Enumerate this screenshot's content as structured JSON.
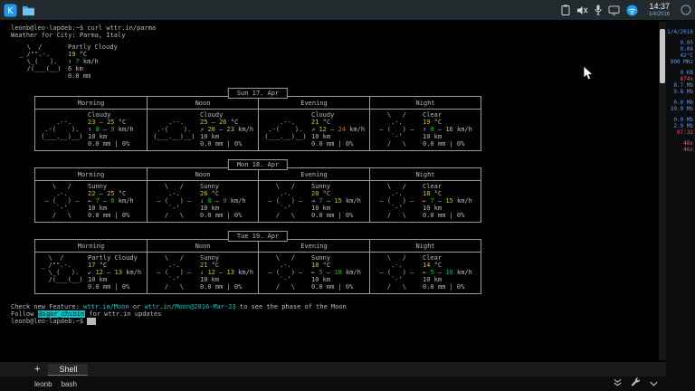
{
  "panel": {
    "time": "14:37",
    "date": "1/4/2016",
    "left_icons": [
      "app-launcher-icon",
      "file-manager-icon"
    ],
    "tray_icons": [
      "clipboard-icon",
      "volume-muted-icon",
      "microphone-icon",
      "display-icon",
      "network-icon"
    ],
    "show_desktop_icon": "show-desktop-icon"
  },
  "terminal": {
    "lines_top": [
      {
        "segs": [
          {
            "t": "leonb@leo-lapdeb:~$ curl wttr.in/parma",
            "c": "w"
          }
        ]
      },
      {
        "segs": [
          {
            "t": "Weather for City: Parma, Italy",
            "c": "w"
          }
        ]
      }
    ],
    "current": {
      "icon": "partly-cloudy",
      "condition": "Partly Cloudy",
      "temp": [
        {
          "t": "19",
          "c": "y"
        },
        {
          "t": " °C",
          "c": "w"
        }
      ],
      "wind": [
        {
          "t": "↑ ",
          "c": "w"
        },
        {
          "t": "7",
          "c": "g"
        },
        {
          "t": " km/h",
          "c": "w"
        }
      ],
      "visibility": "6 km",
      "precip": "0.0 mm"
    },
    "periods": [
      "Morning",
      "Noon",
      "Evening",
      "Night"
    ],
    "days": [
      {
        "label": "Sun 17. Apr",
        "cells": [
          {
            "icon": "cloudy",
            "condition": "Cloudy",
            "temp": [
              {
                "t": "23",
                "c": "y"
              },
              {
                "t": " – ",
                "c": "w"
              },
              {
                "t": "25",
                "c": "y"
              },
              {
                "t": " °C",
                "c": "w"
              }
            ],
            "wind": [
              {
                "t": "↑ ",
                "c": "w"
              },
              {
                "t": "8",
                "c": "g"
              },
              {
                "t": " – ",
                "c": "w"
              },
              {
                "t": "9",
                "c": "g"
              },
              {
                "t": " km/h",
                "c": "w"
              }
            ],
            "visibility": "10 km",
            "precip": "0.0 mm | 0%"
          },
          {
            "icon": "cloudy",
            "condition": "Cloudy",
            "temp": [
              {
                "t": "25",
                "c": "y"
              },
              {
                "t": " – ",
                "c": "w"
              },
              {
                "t": "26",
                "c": "y"
              },
              {
                "t": " °C",
                "c": "w"
              }
            ],
            "wind": [
              {
                "t": "↗ ",
                "c": "w"
              },
              {
                "t": "20",
                "c": "y"
              },
              {
                "t": " – ",
                "c": "w"
              },
              {
                "t": "23",
                "c": "y"
              },
              {
                "t": " km/h",
                "c": "w"
              }
            ],
            "visibility": "10 km",
            "precip": "0.0 mm | 0%"
          },
          {
            "icon": "cloudy",
            "condition": "Cloudy",
            "temp": [
              {
                "t": "21",
                "c": "y"
              },
              {
                "t": " °C",
                "c": "w"
              }
            ],
            "wind": [
              {
                "t": "↗ ",
                "c": "w"
              },
              {
                "t": "12",
                "c": "y"
              },
              {
                "t": " – ",
                "c": "w"
              },
              {
                "t": "24",
                "c": "o"
              },
              {
                "t": " km/h",
                "c": "w"
              }
            ],
            "visibility": "10 km",
            "precip": "0.0 mm | 0%"
          },
          {
            "icon": "clear",
            "condition": "Clear",
            "temp": [
              {
                "t": "19",
                "c": "y"
              },
              {
                "t": " °C",
                "c": "w"
              }
            ],
            "wind": [
              {
                "t": "↑ ",
                "c": "w"
              },
              {
                "t": "8",
                "c": "g"
              },
              {
                "t": " – ",
                "c": "w"
              },
              {
                "t": "16",
                "c": "y"
              },
              {
                "t": " km/h",
                "c": "w"
              }
            ],
            "visibility": "10 km",
            "precip": "0.0 mm | 0%"
          }
        ]
      },
      {
        "label": "Mon 18. Apr",
        "cells": [
          {
            "icon": "sunny",
            "condition": "Sunny",
            "temp": [
              {
                "t": "22",
                "c": "y"
              },
              {
                "t": " – ",
                "c": "w"
              },
              {
                "t": "25",
                "c": "y"
              },
              {
                "t": " °C",
                "c": "w"
              }
            ],
            "wind": [
              {
                "t": "← ",
                "c": "w"
              },
              {
                "t": "7",
                "c": "g"
              },
              {
                "t": " – ",
                "c": "w"
              },
              {
                "t": "8",
                "c": "g"
              },
              {
                "t": " km/h",
                "c": "w"
              }
            ],
            "visibility": "10 km",
            "precip": "0.0 mm | 0%"
          },
          {
            "icon": "sunny",
            "condition": "Sunny",
            "temp": [
              {
                "t": "26",
                "c": "y"
              },
              {
                "t": " °C",
                "c": "w"
              }
            ],
            "wind": [
              {
                "t": "↓ ",
                "c": "w"
              },
              {
                "t": "8",
                "c": "g"
              },
              {
                "t": " – ",
                "c": "w"
              },
              {
                "t": "9",
                "c": "g"
              },
              {
                "t": " km/h",
                "c": "w"
              }
            ],
            "visibility": "10 km",
            "precip": "0.0 mm | 0%"
          },
          {
            "icon": "sunny",
            "condition": "Sunny",
            "temp": [
              {
                "t": "20",
                "c": "y"
              },
              {
                "t": " °C",
                "c": "w"
              }
            ],
            "wind": [
              {
                "t": "→ ",
                "c": "w"
              },
              {
                "t": "7",
                "c": "g"
              },
              {
                "t": " – ",
                "c": "w"
              },
              {
                "t": "15",
                "c": "y"
              },
              {
                "t": " km/h",
                "c": "w"
              }
            ],
            "visibility": "10 km",
            "precip": "0.0 mm | 0%"
          },
          {
            "icon": "clear",
            "condition": "Clear",
            "temp": [
              {
                "t": "18",
                "c": "y"
              },
              {
                "t": " °C",
                "c": "w"
              }
            ],
            "wind": [
              {
                "t": "← ",
                "c": "w"
              },
              {
                "t": "7",
                "c": "g"
              },
              {
                "t": " – ",
                "c": "w"
              },
              {
                "t": "15",
                "c": "y"
              },
              {
                "t": " km/h",
                "c": "w"
              }
            ],
            "visibility": "10 km",
            "precip": "0.0 mm | 0%"
          }
        ]
      },
      {
        "label": "Tue 19. Apr",
        "cells": [
          {
            "icon": "partly-cloudy",
            "condition": "Partly Cloudy",
            "temp": [
              {
                "t": "17",
                "c": "y"
              },
              {
                "t": " °C",
                "c": "w"
              }
            ],
            "wind": [
              {
                "t": "↙ ",
                "c": "w"
              },
              {
                "t": "12",
                "c": "y"
              },
              {
                "t": " – ",
                "c": "w"
              },
              {
                "t": "13",
                "c": "y"
              },
              {
                "t": " km/h",
                "c": "w"
              }
            ],
            "visibility": "10 km",
            "precip": "0.0 mm | 0%"
          },
          {
            "icon": "sunny",
            "condition": "Sunny",
            "temp": [
              {
                "t": "21",
                "c": "y"
              },
              {
                "t": " °C",
                "c": "w"
              }
            ],
            "wind": [
              {
                "t": "↓ ",
                "c": "w"
              },
              {
                "t": "12",
                "c": "y"
              },
              {
                "t": " – ",
                "c": "w"
              },
              {
                "t": "13",
                "c": "y"
              },
              {
                "t": " km/h",
                "c": "w"
              }
            ],
            "visibility": "10 km",
            "precip": "0.0 mm | 0%"
          },
          {
            "icon": "sunny",
            "condition": "Sunny",
            "temp": [
              {
                "t": "18",
                "c": "y"
              },
              {
                "t": " °C",
                "c": "w"
              }
            ],
            "wind": [
              {
                "t": "← ",
                "c": "w"
              },
              {
                "t": "5",
                "c": "g"
              },
              {
                "t": " – ",
                "c": "w"
              },
              {
                "t": "10",
                "c": "g"
              },
              {
                "t": " km/h",
                "c": "w"
              }
            ],
            "visibility": "10 km",
            "precip": "0.0 mm | 0%"
          },
          {
            "icon": "clear",
            "condition": "Clear",
            "temp": [
              {
                "t": "14",
                "c": "y"
              },
              {
                "t": " °C",
                "c": "w"
              }
            ],
            "wind": [
              {
                "t": "← ",
                "c": "w"
              },
              {
                "t": "5",
                "c": "g"
              },
              {
                "t": " – ",
                "c": "w"
              },
              {
                "t": "10",
                "c": "g"
              },
              {
                "t": " km/h",
                "c": "w"
              }
            ],
            "visibility": "10 km",
            "precip": "0.0 mm | 0%"
          }
        ]
      }
    ],
    "icons": {
      "partly-cloudy": [
        "   \\  /",
        " _ /\"\".-.",
        "   \\_(   ).",
        "   /(___(__)",
        ""
      ],
      "cloudy": [
        "",
        "     .--.",
        "  .-(    ).",
        " (___.__)__)",
        ""
      ],
      "sunny": [
        "    \\   /",
        "     .-.",
        "  ― (   ) ―",
        "     `-’",
        "    /   \\"
      ],
      "clear": [
        "    \\   /",
        "     .-.",
        "  ― (   ) ―",
        "     `-’",
        "    /   \\"
      ]
    },
    "lines_bottom": [
      {
        "segs": [
          {
            "t": "Check new Feature: ",
            "c": "w"
          },
          {
            "t": "wttr.in/Moon",
            "c": "c"
          },
          {
            "t": " or ",
            "c": "w"
          },
          {
            "t": "wttr.in/Moon@2016-Mar-23",
            "c": "c"
          },
          {
            "t": " to see the phase of the Moon",
            "c": "w"
          }
        ]
      },
      {
        "segs": [
          {
            "t": "Follow ",
            "c": "w"
          },
          {
            "t": "@igor_chubin",
            "c": "hl"
          },
          {
            "t": " for wttr.in updates",
            "c": "w"
          }
        ]
      },
      {
        "segs": [
          {
            "t": "leonb@leo-lapdeb:~$ ",
            "c": "w"
          },
          {
            "t": " ",
            "c": "cur"
          }
        ]
      }
    ]
  },
  "tabbar": {
    "new_tab_label": "+",
    "tab_label": "Shell"
  },
  "statusbar": {
    "items": [
      "leonb",
      "bash"
    ],
    "icons": [
      "chevrons-down-icon",
      "wrench-icon",
      "chevron-down-icon"
    ]
  },
  "monitor": {
    "lines": [
      {
        "t": "1/4/2016",
        "c": "b"
      },
      {
        "t": "",
        "c": "b"
      },
      {
        "t": "0.05",
        "c": "b"
      },
      {
        "t": "0.08",
        "c": "b"
      },
      {
        "t": "42°C",
        "c": "b"
      },
      {
        "t": "800 MHz",
        "c": "b"
      },
      {
        "t": "",
        "c": "b"
      },
      {
        "t": "0 KB",
        "c": "b"
      },
      {
        "t": "874x",
        "c": "r"
      },
      {
        "t": "8.7 Mb",
        "c": "b"
      },
      {
        "t": "9.8 Mb",
        "c": "b"
      },
      {
        "t": "",
        "c": "b"
      },
      {
        "t": "0.0 Mb",
        "c": "b"
      },
      {
        "t": "39.9 Mb",
        "c": "b"
      },
      {
        "t": "",
        "c": "b"
      },
      {
        "t": "0.0 Mb",
        "c": "b"
      },
      {
        "t": "2.9 Mb",
        "c": "b"
      },
      {
        "t": "07:32",
        "c": "r"
      },
      {
        "t": "",
        "c": "b"
      },
      {
        "t": "48x",
        "c": "r"
      },
      {
        "t": "46x",
        "c": "r"
      }
    ]
  }
}
